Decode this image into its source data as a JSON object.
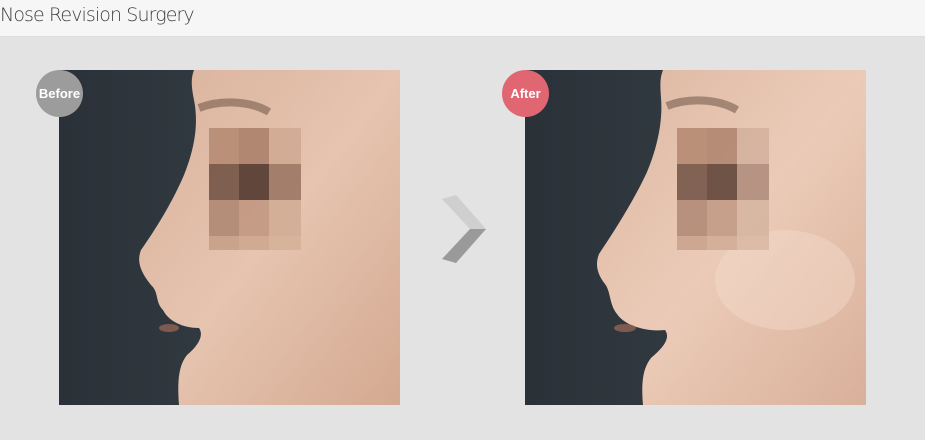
{
  "page": {
    "title": "Nose Revision Surgery"
  },
  "comparison": {
    "before": {
      "badge_label": "Before",
      "badge_color": "#9c9c9c"
    },
    "after": {
      "badge_label": "After",
      "badge_color": "#e06772"
    },
    "arrow_icon": "chevron-right-icon"
  }
}
